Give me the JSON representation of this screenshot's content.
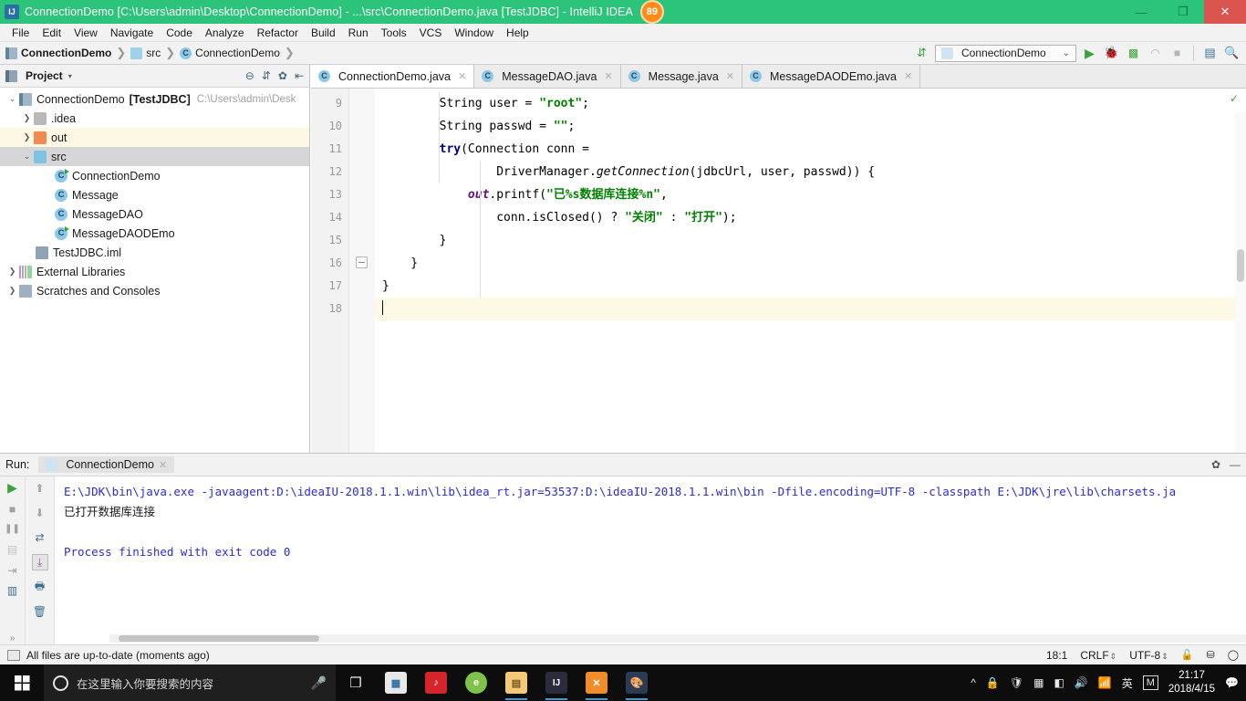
{
  "titlebar": {
    "app_icon": "intellij-icon",
    "title": "ConnectionDemo [C:\\Users\\admin\\Desktop\\ConnectionDemo] - ...\\src\\ConnectionDemo.java [TestJDBC] - IntelliJ IDEA",
    "badge": "89",
    "minimize": "—",
    "maximize": "❐",
    "close": "✕",
    "accent_color": "#2cc37a",
    "close_color": "#d9534f"
  },
  "menubar": {
    "items": [
      "File",
      "Edit",
      "View",
      "Navigate",
      "Code",
      "Analyze",
      "Refactor",
      "Build",
      "Run",
      "Tools",
      "VCS",
      "Window",
      "Help"
    ]
  },
  "navbar": {
    "breadcrumbs": [
      {
        "label": "ConnectionDemo",
        "icon": "module-icon",
        "bold": true
      },
      {
        "label": "src",
        "icon": "folder-icon",
        "bold": false
      },
      {
        "label": "ConnectionDemo",
        "icon": "java-class-icon",
        "bold": false
      }
    ],
    "separator": "❯",
    "sort_icon": "sort-numeric-icon",
    "run_config": {
      "label": "ConnectionDemo",
      "icon": "run-config-icon",
      "chevron": "⌄"
    },
    "actions": [
      {
        "name": "run-button",
        "glyph": "▶",
        "color": "#3aa33a"
      },
      {
        "name": "debug-button",
        "glyph": "🐞",
        "color": "#3aa33a"
      },
      {
        "name": "run-coverage-button",
        "glyph": "▦",
        "color": "#3aa33a"
      },
      {
        "name": "profile-button",
        "glyph": "◠",
        "color": "#a8a8a8"
      },
      {
        "name": "stop-button",
        "glyph": "■",
        "color": "#a8a8a8"
      },
      {
        "name": "database-button",
        "glyph": "▤",
        "color": "#4a6a86"
      },
      {
        "name": "search-everywhere-button",
        "glyph": "🔍",
        "color": "#4a4a4a"
      }
    ]
  },
  "project_panel": {
    "title": "Project",
    "title_icon": "project-icon",
    "caret": "▾",
    "header_actions": [
      {
        "name": "collapse-all-icon",
        "glyph": "⊖"
      },
      {
        "name": "expand-all-icon",
        "glyph": "⇵"
      },
      {
        "name": "settings-gear-icon",
        "glyph": "✿"
      },
      {
        "name": "hide-panel-icon",
        "glyph": "⇤"
      }
    ],
    "tree": [
      {
        "label": "ConnectionDemo",
        "bold_suffix": "[TestJDBC]",
        "path": "C:\\Users\\admin\\Desk",
        "arrow": "⌄",
        "icon": "module-icon",
        "indent": 0,
        "state": "expanded"
      },
      {
        "label": ".idea",
        "arrow": "❯",
        "icon": "folder-grey-icon",
        "indent": 1,
        "state": "collapsed"
      },
      {
        "label": "out",
        "arrow": "❯",
        "icon": "folder-orange-icon",
        "indent": 1,
        "state": "collapsed",
        "highlight": "modified"
      },
      {
        "label": "src",
        "arrow": "⌄",
        "icon": "folder-blue-icon",
        "indent": 1,
        "state": "expanded",
        "highlight": "selected"
      },
      {
        "label": "ConnectionDemo",
        "icon": "java-class-runnable-icon",
        "indent": 2
      },
      {
        "label": "Message",
        "icon": "java-class-icon",
        "indent": 2
      },
      {
        "label": "MessageDAO",
        "icon": "java-class-icon",
        "indent": 2
      },
      {
        "label": "MessageDAODEmo",
        "icon": "java-class-runnable-icon",
        "indent": 2
      },
      {
        "label": "TestJDBC.iml",
        "icon": "iml-file-icon",
        "indent": 1
      },
      {
        "label": "External Libraries",
        "arrow": "❯",
        "icon": "libraries-icon",
        "indent": 0,
        "state": "collapsed"
      },
      {
        "label": "Scratches and Consoles",
        "arrow": "❯",
        "icon": "scratches-icon",
        "indent": 0,
        "state": "collapsed"
      }
    ]
  },
  "editor": {
    "tabs": [
      {
        "label": "ConnectionDemo.java",
        "icon": "java-class-runnable-icon",
        "active": true,
        "close": "✕"
      },
      {
        "label": "MessageDAO.java",
        "icon": "java-class-icon",
        "active": false,
        "close": "✕"
      },
      {
        "label": "Message.java",
        "icon": "java-class-icon",
        "active": false,
        "close": "✕"
      },
      {
        "label": "MessageDAODEmo.java",
        "icon": "java-class-runnable-icon",
        "active": false,
        "close": "✕"
      }
    ],
    "line_numbers": [
      "9",
      "10",
      "11",
      "12",
      "13",
      "14",
      "15",
      "16",
      "17",
      "18"
    ],
    "inspection_status": "✓",
    "cursor_line_index": 9,
    "lines": [
      {
        "n": "9",
        "segments": [
          {
            "t": "        String user = ",
            "c": "plain"
          },
          {
            "t": "\"root\"",
            "c": "str"
          },
          {
            "t": ";",
            "c": "plain"
          }
        ]
      },
      {
        "n": "10",
        "segments": [
          {
            "t": "        String passwd = ",
            "c": "plain"
          },
          {
            "t": "\"\"",
            "c": "str"
          },
          {
            "t": ";",
            "c": "plain"
          }
        ]
      },
      {
        "n": "11",
        "segments": [
          {
            "t": "        ",
            "c": "plain"
          },
          {
            "t": "try",
            "c": "kw"
          },
          {
            "t": "(Connection conn =",
            "c": "plain"
          }
        ]
      },
      {
        "n": "12",
        "segments": [
          {
            "t": "                DriverManager.",
            "c": "plain"
          },
          {
            "t": "getConnection",
            "c": "mth"
          },
          {
            "t": "(jdbcUrl, user, passwd)) {",
            "c": "plain"
          }
        ]
      },
      {
        "n": "13",
        "segments": [
          {
            "t": "            ",
            "c": "plain"
          },
          {
            "t": "out",
            "c": "fld"
          },
          {
            "t": ".printf(",
            "c": "plain"
          },
          {
            "t": "\"已%s数据库连接%n\"",
            "c": "str"
          },
          {
            "t": ",",
            "c": "plain"
          }
        ]
      },
      {
        "n": "14",
        "segments": [
          {
            "t": "                conn.isClosed() ? ",
            "c": "plain"
          },
          {
            "t": "\"关闭\"",
            "c": "str"
          },
          {
            "t": " : ",
            "c": "plain"
          },
          {
            "t": "\"打开\"",
            "c": "str"
          },
          {
            "t": ");",
            "c": "plain"
          }
        ]
      },
      {
        "n": "15",
        "segments": [
          {
            "t": "        }",
            "c": "plain"
          }
        ]
      },
      {
        "n": "16",
        "segments": [
          {
            "t": "    }",
            "c": "plain"
          }
        ]
      },
      {
        "n": "17",
        "segments": [
          {
            "t": "}",
            "c": "plain"
          }
        ]
      },
      {
        "n": "18",
        "segments": [
          {
            "t": "",
            "c": "plain"
          }
        ]
      }
    ]
  },
  "run_panel": {
    "label": "Run:",
    "tab": {
      "label": "ConnectionDemo",
      "icon": "run-config-icon",
      "close": "✕"
    },
    "header_actions": [
      {
        "name": "settings-gear-icon",
        "glyph": "✿"
      },
      {
        "name": "minimize-panel-icon",
        "glyph": "—"
      }
    ],
    "left_tools": [
      {
        "name": "rerun-button",
        "glyph": "▶",
        "color": "#3aa33a"
      },
      {
        "name": "stop-button",
        "glyph": "■",
        "color": "#a0a0a0"
      },
      {
        "name": "pause-button",
        "glyph": "❚❚",
        "color": "#a0a0a0"
      },
      {
        "name": "restore-layout-button",
        "glyph": "▤",
        "color": "#c0c0c0"
      },
      {
        "name": "dump-threads-button",
        "glyph": "⇥",
        "color": "#a0a0a0"
      },
      {
        "name": "console-toggle-button",
        "glyph": "▥",
        "color": "#4a6a86"
      },
      {
        "name": "expand-button",
        "glyph": "»",
        "color": "#888"
      }
    ],
    "right_tools": [
      {
        "name": "scroll-up-icon",
        "glyph": "⬆",
        "color": "#a0a0a0"
      },
      {
        "name": "scroll-down-icon",
        "glyph": "⬇",
        "color": "#a0a0a0"
      },
      {
        "name": "soft-wrap-icon",
        "glyph": "⇄",
        "color": "#4a6a86"
      },
      {
        "name": "scroll-to-end-icon",
        "glyph": "⤓",
        "color": "#8a5aa8"
      },
      {
        "name": "print-icon",
        "glyph": "🖶",
        "color": "#4a6a86"
      },
      {
        "name": "clear-all-icon",
        "glyph": "🗑",
        "color": "#4a6a86"
      }
    ],
    "console": {
      "command": "E:\\JDK\\bin\\java.exe -javaagent:D:\\ideaIU-2018.1.1.win\\lib\\idea_rt.jar=53537:D:\\ideaIU-2018.1.1.win\\bin -Dfile.encoding=UTF-8 -classpath E:\\JDK\\jre\\lib\\charsets.ja",
      "output": "已打开数据库连接",
      "process": "Process finished with exit code 0"
    }
  },
  "statusbar": {
    "message": "All files are up-to-date (moments ago)",
    "message_icon": "build-icon",
    "position": "18:1",
    "line_separator": "CRLF",
    "encoding": "UTF-8",
    "lock_icon": "unlocked-icon",
    "vcs_icon": "branch-icon",
    "event_log_icon": "event-log-icon"
  },
  "taskbar": {
    "start_icon": "windows-logo-icon",
    "search_placeholder": "在这里输入你要搜索的内容",
    "cortana_icon": "cortana-circle-icon",
    "mic_icon": "microphone-icon",
    "task_view_icon": "task-view-icon",
    "store_icon": "microsoft-store-icon",
    "apps": [
      {
        "name": "netease-music-icon",
        "glyph": "♪",
        "bg": "#d4262a",
        "running": false
      },
      {
        "name": "browser-icon",
        "glyph": "e",
        "bg": "#7ec24a",
        "running": false
      },
      {
        "name": "file-explorer-icon",
        "glyph": "▤",
        "bg": "#f5c87a",
        "running": true
      },
      {
        "name": "intellij-idea-icon",
        "glyph": "IJ",
        "bg": "#2b2b3d",
        "running": true
      },
      {
        "name": "xampp-icon",
        "glyph": "✕",
        "bg": "#f18c2a",
        "running": true
      },
      {
        "name": "paint-icon",
        "glyph": "🎨",
        "bg": "#2b3a55",
        "running": true
      }
    ],
    "tray": {
      "show_hidden_icon": "^",
      "items": [
        "🔒",
        "🛡",
        "▦",
        "◧"
      ],
      "volume_icon": "🔊",
      "network_icon": "📶",
      "ime_lang": "英",
      "ime_mode": "M",
      "time": "21:17",
      "date": "2018/4/15",
      "notification_icon": "💬"
    }
  }
}
